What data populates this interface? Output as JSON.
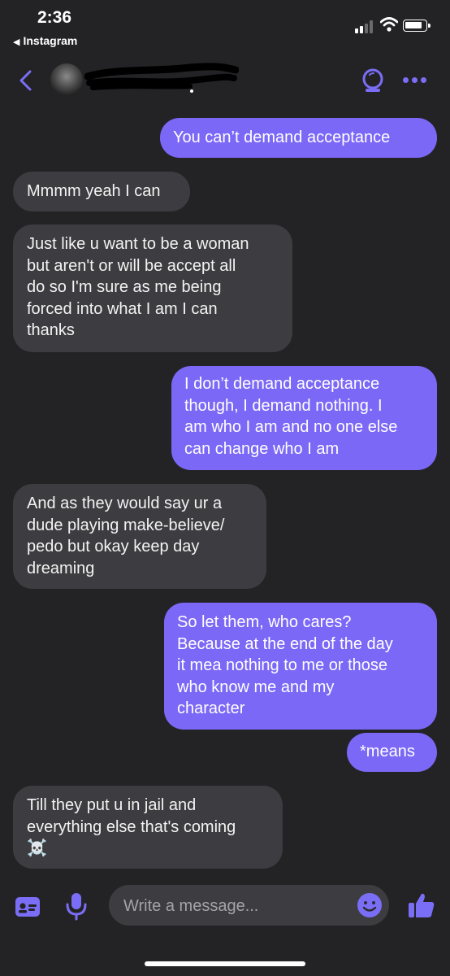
{
  "status_bar": {
    "time": "2:36",
    "back_app": "Instagram"
  },
  "header": {
    "contact_name": "",
    "accent": "#7b6ef6"
  },
  "messages": [
    {
      "direction": "outgoing",
      "text": "You can’t demand acceptance"
    },
    {
      "direction": "incoming",
      "text": "Mmmm yeah I can"
    },
    {
      "direction": "incoming",
      "text": "Just like u want to be a woman\nbut aren't or will be accept all\ndo so I'm sure as me being\nforced into what I am I can\nthanks"
    },
    {
      "direction": "outgoing",
      "text": "I don’t demand acceptance\nthough, I demand nothing. I\nam who I am and no one else\ncan change who I am"
    },
    {
      "direction": "incoming",
      "text": "And as they would say ur a\ndude playing make-believe/\npedo but okay keep day\ndreaming"
    },
    {
      "direction": "outgoing",
      "text": "So let them, who cares?\nBecause at the end of the day\nit mea nothing to me or those\nwho know me and my\ncharacter"
    },
    {
      "direction": "outgoing",
      "text": "*means"
    },
    {
      "direction": "incoming",
      "text": "Till they put u in jail and\neverything else that's coming\n☠️"
    }
  ],
  "composer": {
    "placeholder": "Write a message...",
    "icons": [
      "card-icon",
      "microphone-icon",
      "emoji-icon",
      "thumbs-up-icon"
    ]
  },
  "colors": {
    "background": "#232326",
    "outgoing_bubble": "#7b68f6",
    "incoming_bubble": "#3d3d41",
    "accent": "#7b6ef6"
  }
}
